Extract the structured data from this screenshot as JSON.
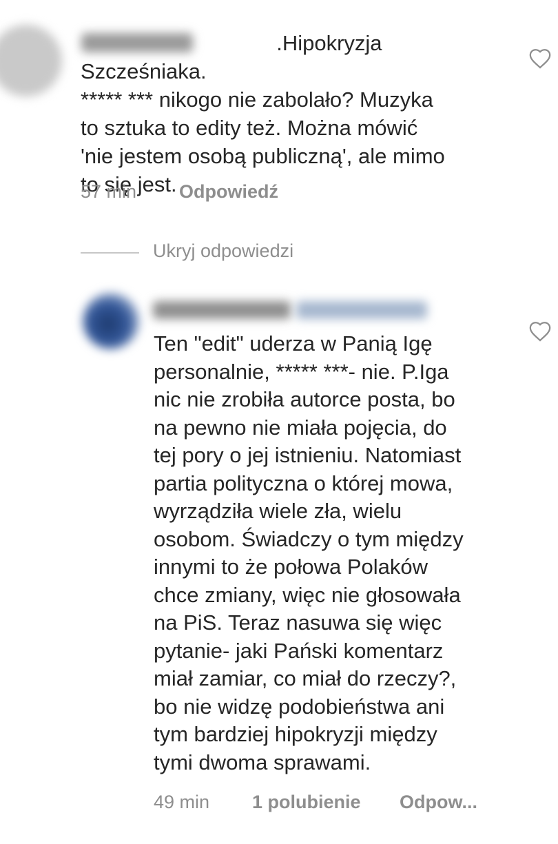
{
  "comments": [
    {
      "text": "                                 .Hipokryzja Szcześniaka.\n***** *** nikogo nie zabolało? Muzyka\nto sztuka to edity też. Można mówić\n'nie jestem osobą publiczną', ale mimo\nto się jest.",
      "time": "57 min",
      "reply_label": "Odpowiedź",
      "like_icon": "heart-outline-icon"
    },
    {
      "text": "Ten \"edit\" uderza w Panią Igę\npersonalnie, ***** ***- nie.  P.Iga\nnic nie zrobiła autorce posta, bo\nna pewno nie miała pojęcia, do\ntej pory o jej istnieniu. Natomiast\npartia polityczna o której mowa,\nwyrządziła wiele zła, wielu\nosobom. Świadczy o tym między\ninnymi to że połowa Polaków\nchce zmiany, więc nie głosowała\nna PiS. Teraz nasuwa się więc\npytanie- jaki Pański komentarz\nmiał zamiar, co miał do rzeczy?,\nbo nie widzę podobieństwa ani\ntym bardziej hipokryzji między\ntymi dwoma sprawami.",
      "time": "49 min",
      "likes": "1 polubienie",
      "reply_label": "Odpow...",
      "like_icon": "heart-outline-icon"
    }
  ],
  "hide_replies": "Ukryj odpowiedzi",
  "colors": {
    "text": "#262626",
    "meta": "#8e8e8e",
    "divider": "#c7c7c7"
  }
}
